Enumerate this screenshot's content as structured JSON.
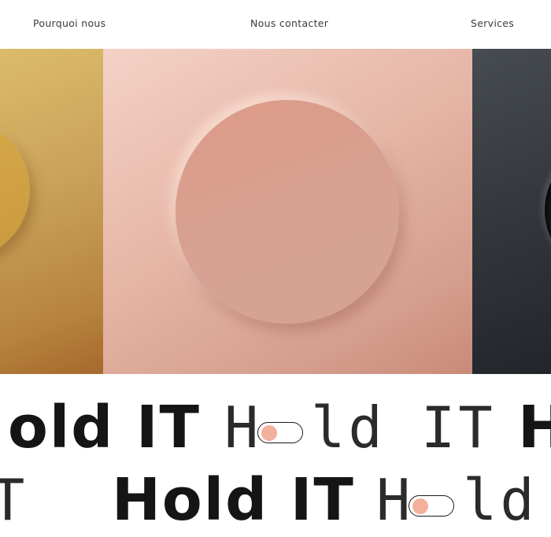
{
  "nav": {
    "items": [
      {
        "label": "Pourquoi nous"
      },
      {
        "label": "Nous contacter"
      },
      {
        "label": "Services"
      }
    ]
  },
  "slider": {
    "panels": [
      {
        "name": "gold",
        "accent": "#c99a3e"
      },
      {
        "name": "pink",
        "accent": "#d7a293"
      },
      {
        "name": "dark",
        "accent": "#1e2124"
      }
    ]
  },
  "marquee": {
    "row1": {
      "bold_1": "old IT",
      "thin_h": "H",
      "thin_ld": "ld",
      "thin_it": "IT",
      "bold_2": "H"
    },
    "row2": {
      "thin_t": "T",
      "bold_1": "Hold IT",
      "thin_h": "H",
      "thin_ld": "ld"
    }
  },
  "colors": {
    "toggle_knob": "#f3b09d",
    "text": "#151515"
  }
}
